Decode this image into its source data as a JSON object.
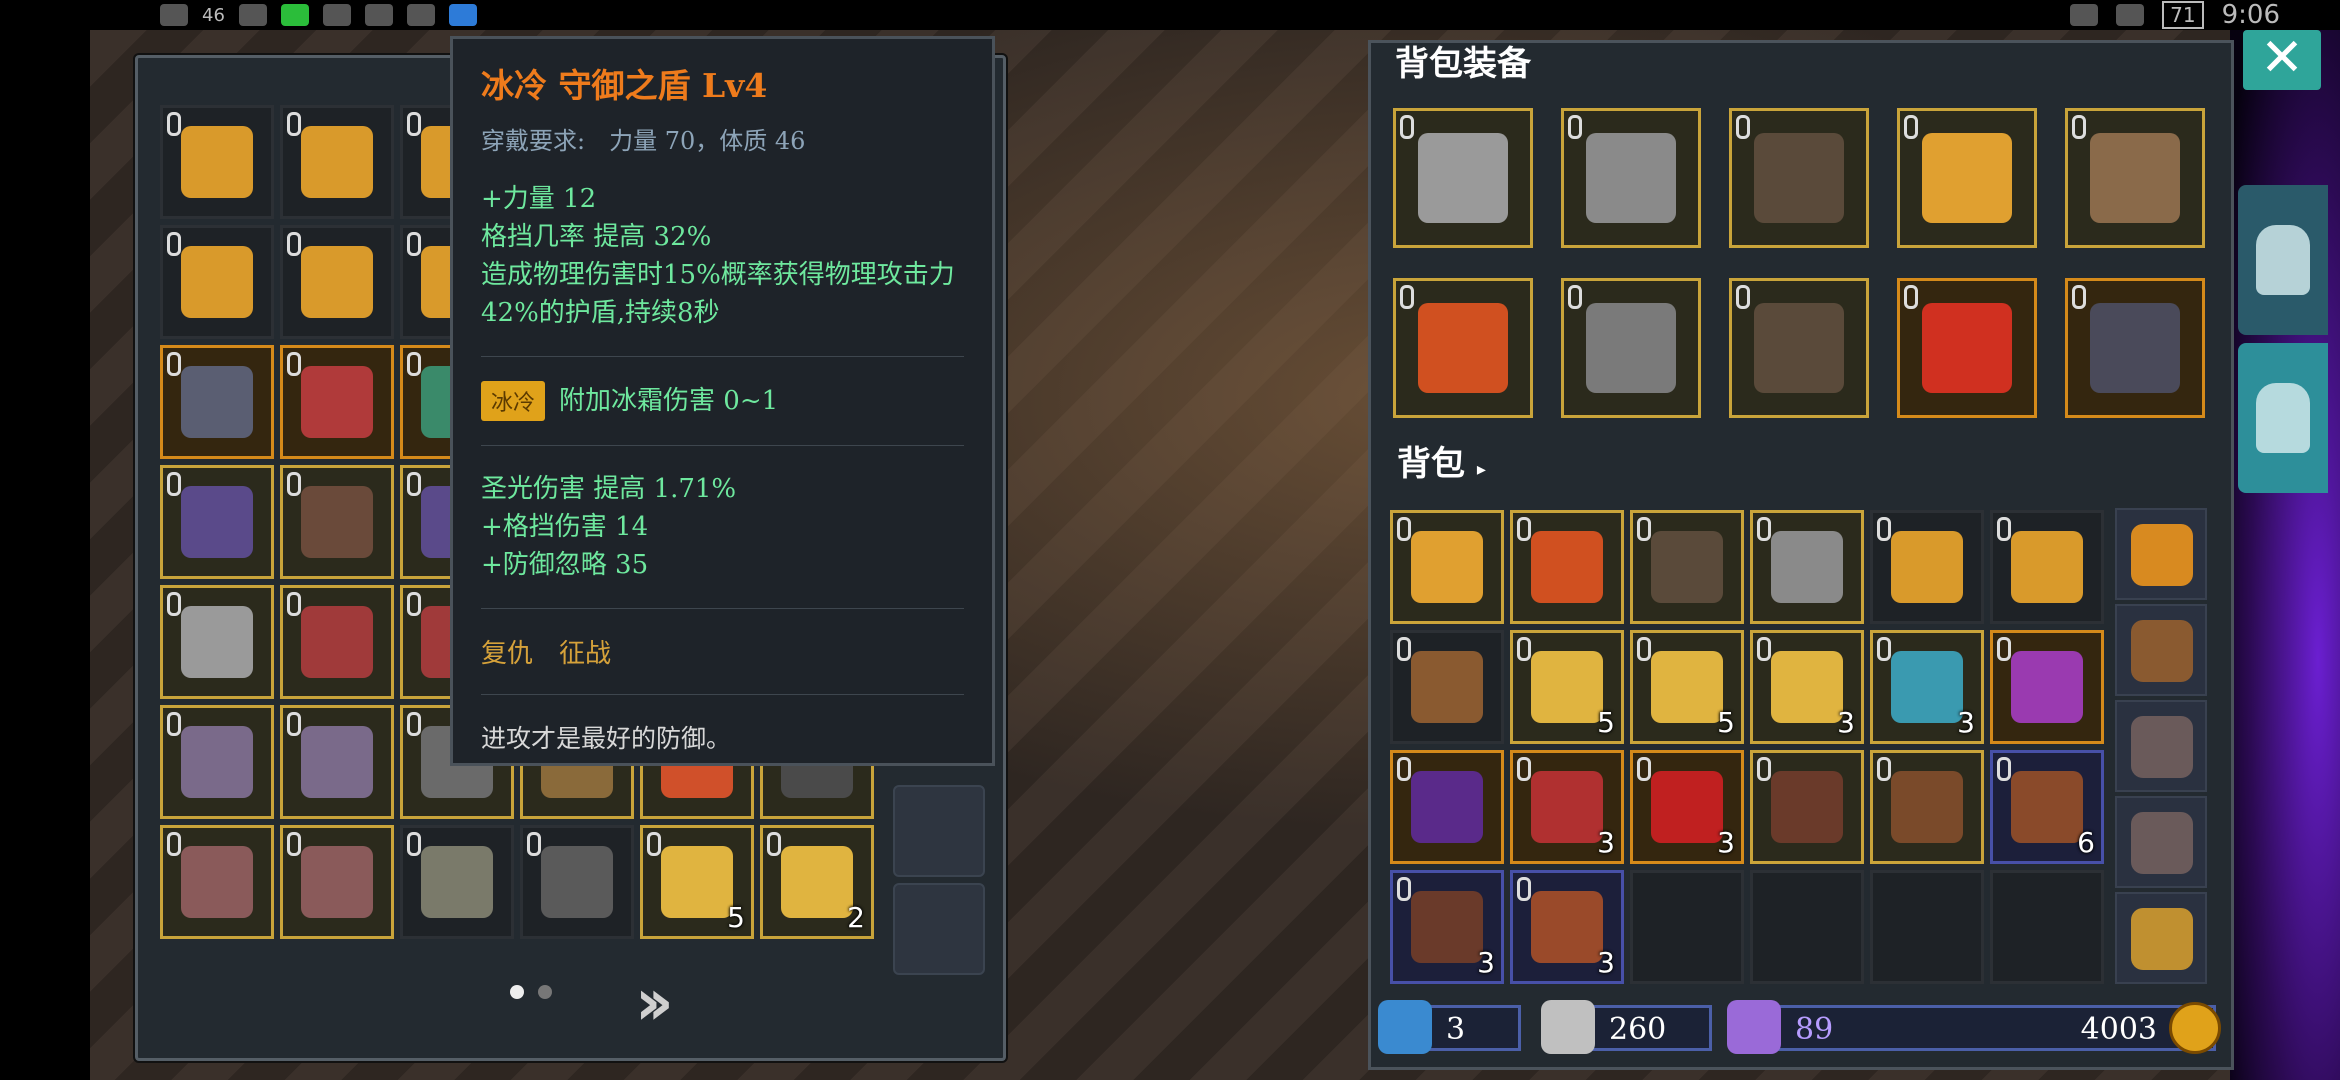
{
  "status_bar": {
    "network": "46",
    "battery": "71",
    "time": "9:06"
  },
  "tooltip": {
    "title": "冰冷 守御之盾 Lv4",
    "requirement": "穿戴要求:　力量 70，体质 46",
    "stats_main": [
      "+力量 12",
      "格挡几率 提高 32%",
      "造成物理伤害时15%概率获得物理攻击力42%的护盾,持续8秒"
    ],
    "ice_badge": "冰冷",
    "ice_effect": "附加冰霜伤害 0~1",
    "stats_extra": [
      "圣光伤害 提高 1.71%",
      "+格挡伤害 14",
      "+防御忽略 35"
    ],
    "suits": "复仇　征战",
    "flavor": "进攻才是最好的防御。"
  },
  "left_inventory": {
    "slots": [
      {
        "border": "empty",
        "color": "#d99a2b",
        "count": ""
      },
      {
        "border": "empty",
        "color": "#d99a2b",
        "count": ""
      },
      {
        "border": "empty",
        "color": "#d99a2b",
        "count": ""
      },
      {
        "border": "empty",
        "color": "#d99a2b",
        "count": ""
      },
      {
        "border": "empty",
        "color": "#d99a2b",
        "count": ""
      },
      {
        "border": "empty",
        "color": "#d99a2b",
        "count": ""
      },
      {
        "border": "empty",
        "color": "#d99a2b",
        "count": ""
      },
      {
        "border": "empty",
        "color": "#d99a2b",
        "count": ""
      },
      {
        "border": "empty",
        "color": "#d99a2b",
        "count": ""
      },
      {
        "border": "empty",
        "color": "#d99a2b",
        "count": ""
      },
      {
        "border": "empty",
        "color": "#d99a2b",
        "count": ""
      },
      {
        "border": "empty",
        "color": "#d99a2b",
        "count": ""
      },
      {
        "border": "orange",
        "color": "#5a5e72",
        "count": ""
      },
      {
        "border": "orange",
        "color": "#b03a3a",
        "count": ""
      },
      {
        "border": "orange",
        "color": "#3a8a6a",
        "count": ""
      },
      {
        "border": "gold",
        "color": "#6a6a6a",
        "count": ""
      },
      {
        "border": "gold",
        "color": "#6a6a6a",
        "count": ""
      },
      {
        "border": "gold",
        "color": "#6a6a6a",
        "count": ""
      },
      {
        "border": "gold",
        "color": "#5a4a8a",
        "count": ""
      },
      {
        "border": "gold",
        "color": "#6a4a3a",
        "count": ""
      },
      {
        "border": "gold",
        "color": "#5a4a8a",
        "count": ""
      },
      {
        "border": "gold",
        "color": "#6a6a6a",
        "count": ""
      },
      {
        "border": "gold",
        "color": "#6a6a6a",
        "count": ""
      },
      {
        "border": "gold",
        "color": "#6a6a6a",
        "count": ""
      },
      {
        "border": "gold",
        "color": "#9a9a9a",
        "count": ""
      },
      {
        "border": "gold",
        "color": "#a03a3a",
        "count": ""
      },
      {
        "border": "gold",
        "color": "#a03a3a",
        "count": ""
      },
      {
        "border": "gold",
        "color": "#6a6a6a",
        "count": ""
      },
      {
        "border": "gold",
        "color": "#6a6a6a",
        "count": ""
      },
      {
        "border": "gold",
        "color": "#6a6a6a",
        "count": ""
      },
      {
        "border": "gold",
        "color": "#7a6a8a",
        "count": ""
      },
      {
        "border": "gold",
        "color": "#7a6a8a",
        "count": ""
      },
      {
        "border": "gold",
        "color": "#6a6a6a",
        "count": ""
      },
      {
        "border": "gold",
        "color": "#8a6a3a",
        "count": ""
      },
      {
        "border": "gold",
        "color": "#d0502a",
        "count": ""
      },
      {
        "border": "gold",
        "color": "#4a4a4a",
        "count": ""
      },
      {
        "border": "gold",
        "color": "#8a5a5a",
        "count": ""
      },
      {
        "border": "gold",
        "color": "#8a5a5a",
        "count": ""
      },
      {
        "border": "empty",
        "color": "#7a7a6a",
        "count": ""
      },
      {
        "border": "empty",
        "color": "#5a5a5a",
        "count": ""
      },
      {
        "border": "gold",
        "color": "#e0b440",
        "count": "5"
      },
      {
        "border": "gold",
        "color": "#e0b440",
        "count": "2"
      }
    ]
  },
  "equipment": {
    "title": "背包装备",
    "slots": [
      {
        "border": "gold",
        "color": "#9a9a9a"
      },
      {
        "border": "gold",
        "color": "#8a8a8a"
      },
      {
        "border": "gold",
        "color": "#5a4a3a"
      },
      {
        "border": "gold",
        "color": "#e0a030"
      },
      {
        "border": "gold",
        "color": "#8a6a4a"
      },
      {
        "border": "gold",
        "color": "#d05020"
      },
      {
        "border": "gold",
        "color": "#7a7a7a"
      },
      {
        "border": "gold",
        "color": "#5a4a3a"
      },
      {
        "border": "orange",
        "color": "#d03020"
      },
      {
        "border": "orange",
        "color": "#4a4a5a"
      }
    ]
  },
  "backpack": {
    "title": "背包",
    "slots": [
      {
        "border": "gold",
        "color": "#e0a030",
        "count": ""
      },
      {
        "border": "gold",
        "color": "#d05020",
        "count": ""
      },
      {
        "border": "gold",
        "color": "#5a4a3a",
        "count": ""
      },
      {
        "border": "gold",
        "color": "#8a8a8a",
        "count": ""
      },
      {
        "border": "empty",
        "color": "#d99a2b",
        "count": ""
      },
      {
        "border": "empty",
        "color": "#d99a2b",
        "count": ""
      },
      {
        "border": "empty",
        "color": "#8a5a30",
        "count": ""
      },
      {
        "border": "gold",
        "color": "#e0b440",
        "count": "5"
      },
      {
        "border": "gold",
        "color": "#e0b440",
        "count": "5"
      },
      {
        "border": "gold",
        "color": "#e0b440",
        "count": "3"
      },
      {
        "border": "gold",
        "color": "#3a9ab0",
        "count": "3"
      },
      {
        "border": "orange",
        "color": "#9a3ab0",
        "count": ""
      },
      {
        "border": "orange",
        "color": "#5a2a8a",
        "count": ""
      },
      {
        "border": "orange",
        "color": "#b03030",
        "count": "3"
      },
      {
        "border": "orange",
        "color": "#c02020",
        "count": "3"
      },
      {
        "border": "gold",
        "color": "#6a3a2a",
        "count": ""
      },
      {
        "border": "gold",
        "color": "#7a4a2a",
        "count": ""
      },
      {
        "border": "blue",
        "color": "#8a4a2a",
        "count": "6"
      },
      {
        "border": "blue",
        "color": "#6a3a2a",
        "count": "3"
      },
      {
        "border": "blue",
        "color": "#9a4a2a",
        "count": "3"
      },
      {
        "border": "empty",
        "color": "",
        "count": ""
      },
      {
        "border": "empty",
        "color": "",
        "count": ""
      },
      {
        "border": "empty",
        "color": "",
        "count": ""
      },
      {
        "border": "empty",
        "color": "",
        "count": ""
      }
    ],
    "side": [
      {
        "color": "#d88a20"
      },
      {
        "color": "#8a5a30"
      },
      {
        "color": "#6a5a5a"
      },
      {
        "color": "#6a5a5a"
      },
      {
        "color": "#c09030"
      }
    ]
  },
  "currencies": {
    "keys": "3",
    "essence": "260",
    "crystals": "89",
    "gold": "4003"
  },
  "pager": {
    "current": 1,
    "total": 2
  }
}
